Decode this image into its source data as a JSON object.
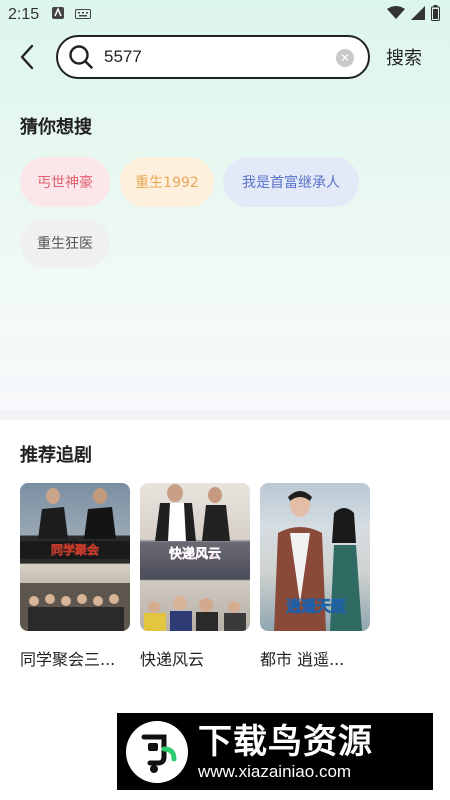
{
  "status_bar": {
    "time": "2:15"
  },
  "search": {
    "query": "5577",
    "submit_label": "搜索"
  },
  "suggestions": {
    "title": "猜你想搜",
    "items": [
      {
        "label": "丐世神豪",
        "color": "#e0616f",
        "bg": "#fbe6ea"
      },
      {
        "label": "重生1992",
        "color": "#e8a85a",
        "bg": "#fdf0dc"
      },
      {
        "label": "我是首富继承人",
        "color": "#5a74c8",
        "bg": "#e4e9f8"
      },
      {
        "label": "重生狂医",
        "color": "#555555",
        "bg": "#eff0f2"
      }
    ]
  },
  "recommend": {
    "title": "推荐追剧",
    "items": [
      {
        "title": "同学聚会三...",
        "poster_text": "同学聚会"
      },
      {
        "title": "快递风云",
        "poster_text": "快递风云"
      },
      {
        "title": "都市 逍遥...",
        "poster_text": "逍遥天医"
      }
    ]
  },
  "watermark": {
    "brand": "下载鸟资源",
    "url": "www.xiazainiao.com"
  },
  "colors": {
    "accent_gradient_top": "#dcf5ee",
    "text_primary": "#222222"
  }
}
